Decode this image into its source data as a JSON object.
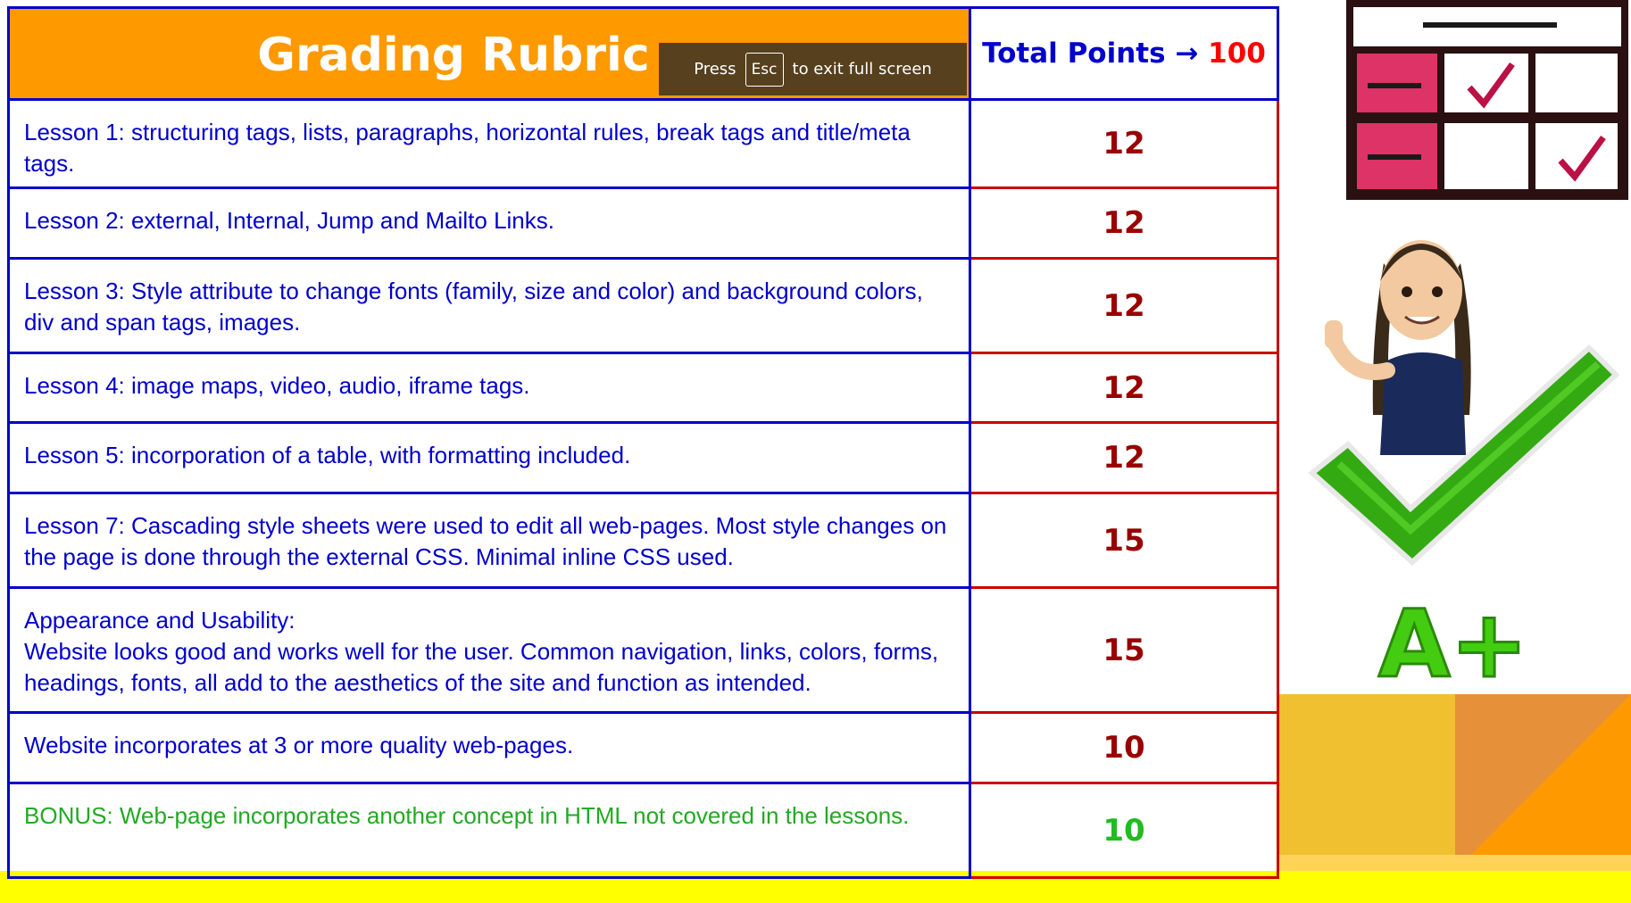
{
  "header": {
    "title": "Grading Rubric",
    "total_label": "Total Points",
    "arrow": "→",
    "total_value": "100"
  },
  "fullscreen_notice": {
    "press": "Press",
    "key": "Esc",
    "message": "to exit full screen"
  },
  "rows": [
    {
      "text": "Lesson 1: structuring tags, lists, paragraphs, horizontal rules, break tags and title/meta tags.",
      "points": "12"
    },
    {
      "text": "Lesson 2: external, Internal, Jump and Mailto Links.",
      "points": "12"
    },
    {
      "text": "Lesson 3: Style attribute to change fonts (family, size and color) and background colors, div and span tags, images.",
      "points": "12"
    },
    {
      "text": "Lesson 4: image maps, video, audio, iframe tags.",
      "points": "12"
    },
    {
      "text": "Lesson 5: incorporation of a table, with formatting included.",
      "points": "12"
    },
    {
      "text": "Lesson 7: Cascading style sheets were used to edit all web-pages. Most style changes on the page is done through the external CSS. Minimal inline CSS used.",
      "points": "15"
    },
    {
      "line1": "Appearance and Usability:",
      "line2": "Website looks good and works well for the user. Common navigation, links, colors, forms, headings, fonts, all add to the aesthetics of the site and function as intended.",
      "points": "15"
    },
    {
      "text": "Website incorporates at 3 or more quality web-pages.",
      "points": "10"
    },
    {
      "text": "BONUS: Web-page incorporates another concept in HTML not covered in the lessons.",
      "points": "10"
    }
  ],
  "graphics": {
    "grid_icon": "checklist-grid-icon",
    "avatar": "avatar-thumbs-up",
    "check": "green-checkmark-icon",
    "grade": "A+",
    "colors": {
      "header_orange": "#ff9900",
      "border_blue": "#0000cc",
      "points_red": "#990000",
      "bonus_green": "#22aa22",
      "stripe_yellow": "#ffff00"
    }
  }
}
